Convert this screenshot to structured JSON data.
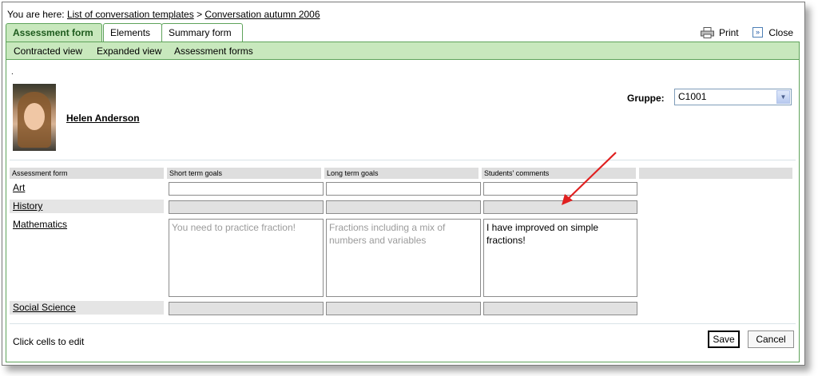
{
  "breadcrumb": {
    "prefix": "You are here:",
    "link1": "List of conversation templates",
    "separator": ">",
    "link2": "Conversation autumn 2006"
  },
  "tabs": [
    {
      "label": "Assessment form",
      "active": true
    },
    {
      "label": "Elements",
      "active": false
    },
    {
      "label": "Summary form",
      "active": false
    }
  ],
  "actions": {
    "print_label": "Print",
    "close_label": "Close",
    "print_icon": "printer-icon",
    "close_icon": "double-arrow-icon"
  },
  "subnav": [
    "Contracted view",
    "Expanded view",
    "Assessment forms"
  ],
  "marker": ".",
  "student": {
    "name": "Helen Anderson"
  },
  "group": {
    "label": "Gruppe:",
    "value": "C1001"
  },
  "table": {
    "headers": [
      "Assessment form",
      "Short term goals",
      "Long term goals",
      "Students' comments"
    ],
    "rows": [
      {
        "subject": "Art",
        "short": "",
        "long": "",
        "comment": ""
      },
      {
        "subject": "History",
        "short": "",
        "long": "",
        "comment": ""
      },
      {
        "subject": "Mathematics",
        "short": "You need to practice fraction!",
        "long": "Fractions including a mix of numbers and variables",
        "comment": "I have improved on simple fractions!"
      },
      {
        "subject": "Social Science",
        "short": "",
        "long": "",
        "comment": ""
      }
    ]
  },
  "footer": {
    "hint": "Click cells to edit",
    "save_label": "Save",
    "cancel_label": "Cancel"
  },
  "colors": {
    "tab_green": "#c8e8bd",
    "border_green": "#5ea35a",
    "arrow_red": "#e02020"
  }
}
